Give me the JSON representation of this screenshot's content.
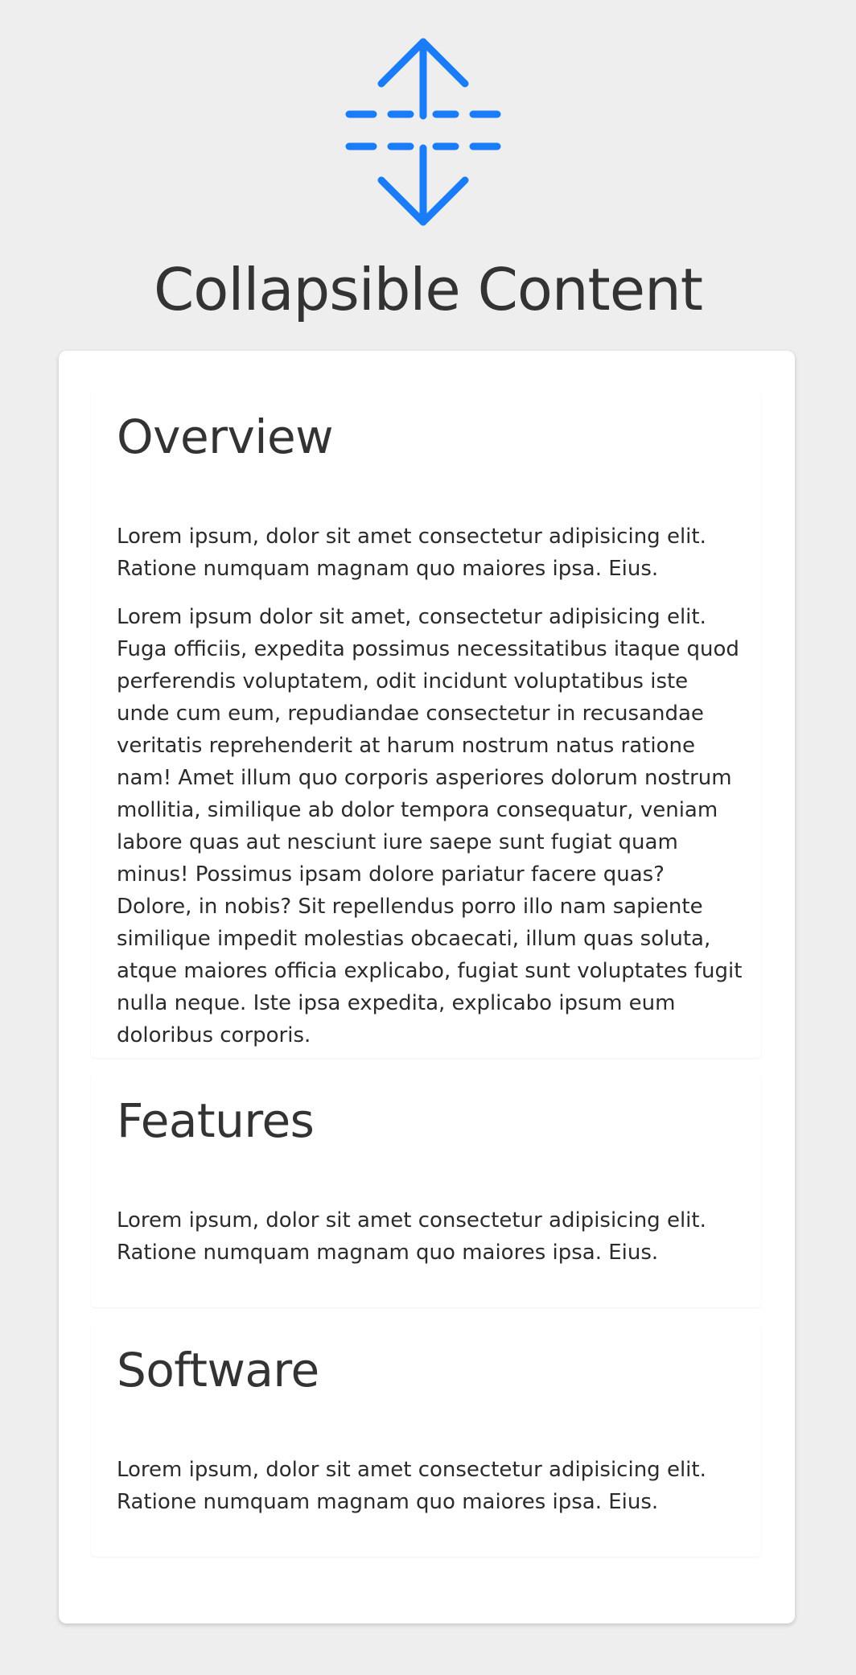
{
  "page": {
    "title": "Collapsible Content",
    "accent_color": "#1a7cf7",
    "icon": "expand-collapse-icon"
  },
  "sections": [
    {
      "title": "Overview",
      "paragraphs": [
        "Lorem ipsum, dolor sit amet consectetur adipisicing elit. Ratione numquam magnam quo maiores ipsa. Eius.",
        "Lorem ipsum dolor sit amet, consectetur adipisicing elit. Fuga officiis, expedita possimus necessitatibus itaque quod perferendis voluptatem, odit incidunt voluptatibus iste unde cum eum, repudiandae consectetur in recusandae veritatis reprehenderit at harum nostrum natus ratione nam! Amet illum quo corporis asperiores dolorum nostrum mollitia, similique ab dolor tempora consequatur, veniam labore quas aut nesciunt iure saepe sunt fugiat quam minus! Possimus ipsam dolore pariatur facere quas? Dolore, in nobis? Sit repellendus porro illo nam sapiente similique impedit molestias obcaecati, illum quas soluta, atque maiores officia explicabo, fugiat sunt voluptates fugit nulla neque. Iste ipsa expedita, explicabo ipsum eum doloribus corporis."
      ]
    },
    {
      "title": "Features",
      "paragraphs": [
        "Lorem ipsum, dolor sit amet consectetur adipisicing elit. Ratione numquam magnam quo maiores ipsa. Eius."
      ]
    },
    {
      "title": "Software",
      "paragraphs": [
        "Lorem ipsum, dolor sit amet consectetur adipisicing elit. Ratione numquam magnam quo maiores ipsa. Eius."
      ]
    }
  ]
}
